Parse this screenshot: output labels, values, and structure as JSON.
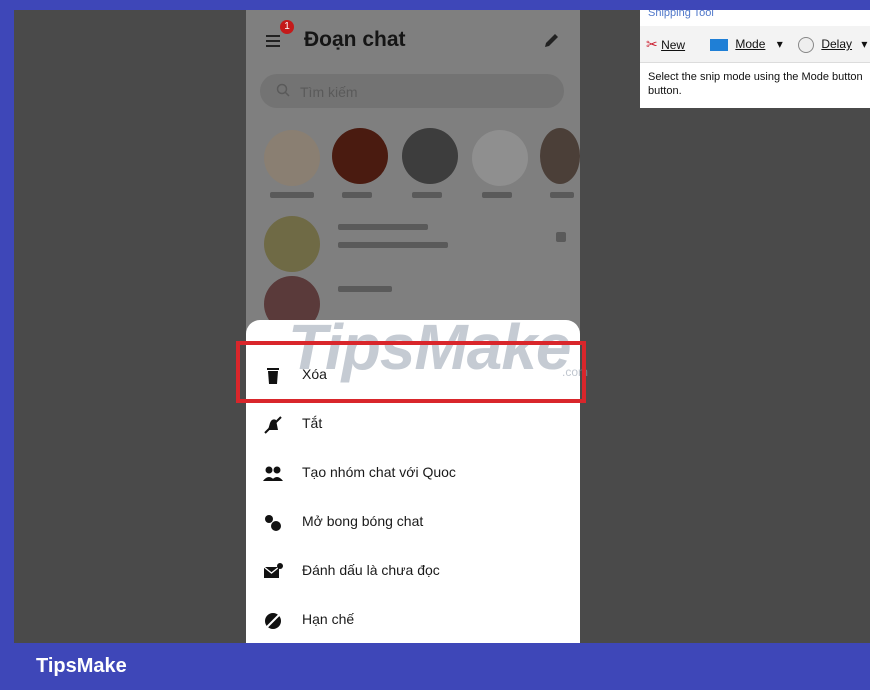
{
  "messenger": {
    "title": "Đoạn chat",
    "badge_count": "1",
    "search_placeholder": "Tìm kiếm"
  },
  "sheet": {
    "items": [
      {
        "label": "Xóa",
        "icon": "trash-icon"
      },
      {
        "label": "Tắt",
        "icon": "bell-off-icon"
      },
      {
        "label": "Tạo nhóm chat với Quoc",
        "icon": "group-icon"
      },
      {
        "label": "Mở bong bóng chat",
        "icon": "chat-bubbles-icon"
      },
      {
        "label": "Đánh dấu là chưa đọc",
        "icon": "mail-unread-icon"
      },
      {
        "label": "Hạn chế",
        "icon": "restrict-icon"
      }
    ]
  },
  "snipping_tool": {
    "title": "Snipping Tool",
    "new_label": "New",
    "mode_label": "Mode",
    "delay_label": "Delay",
    "description_line1": "Select the snip mode using the Mode button",
    "description_line2": "button."
  },
  "watermark": {
    "text": "TipsMake",
    "domain": ".com"
  },
  "footer": {
    "label": "TipsMake"
  },
  "colors": {
    "frame": "#3e47b8",
    "highlight": "#d9262b",
    "badge": "#c41a1a"
  }
}
